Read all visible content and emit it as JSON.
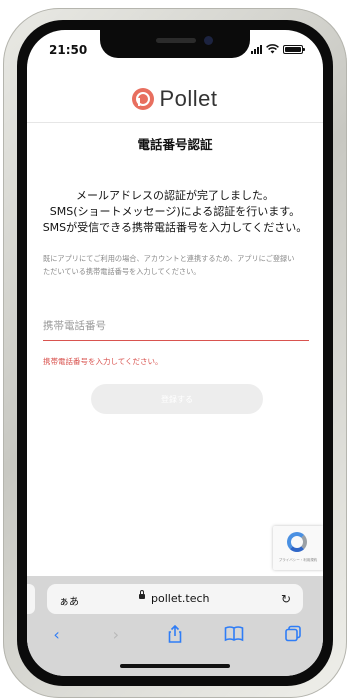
{
  "status": {
    "time": "21:50"
  },
  "header": {
    "logo_text": "Pollet"
  },
  "page": {
    "title": "電話番号認証",
    "message_lines": [
      "メールアドレスの認証が完了しました。",
      "SMS(ショートメッセージ)による認証を行います。",
      "SMSが受信できる携帯電話番号を入力してください。"
    ],
    "note_lines": [
      "既にアプリにてご利用の場合、アカウントと連携するため、アプリにご登録い",
      "ただいている携帯電話番号を入力してください。"
    ]
  },
  "form": {
    "phone_placeholder": "携帯電話番号",
    "phone_value": "",
    "error_text": "携帯電話番号を入力してください。",
    "submit_label": "登録する"
  },
  "recaptcha": {
    "text": "プライバシー・利用規約"
  },
  "browser": {
    "text_size_label": "ぁあ",
    "url": "pollet.tech",
    "reload_icon": "↻",
    "back_icon": "‹",
    "forward_icon": "›",
    "share_icon": "⇪",
    "bookmarks_icon": "📖",
    "tabs_icon": "⧉"
  }
}
